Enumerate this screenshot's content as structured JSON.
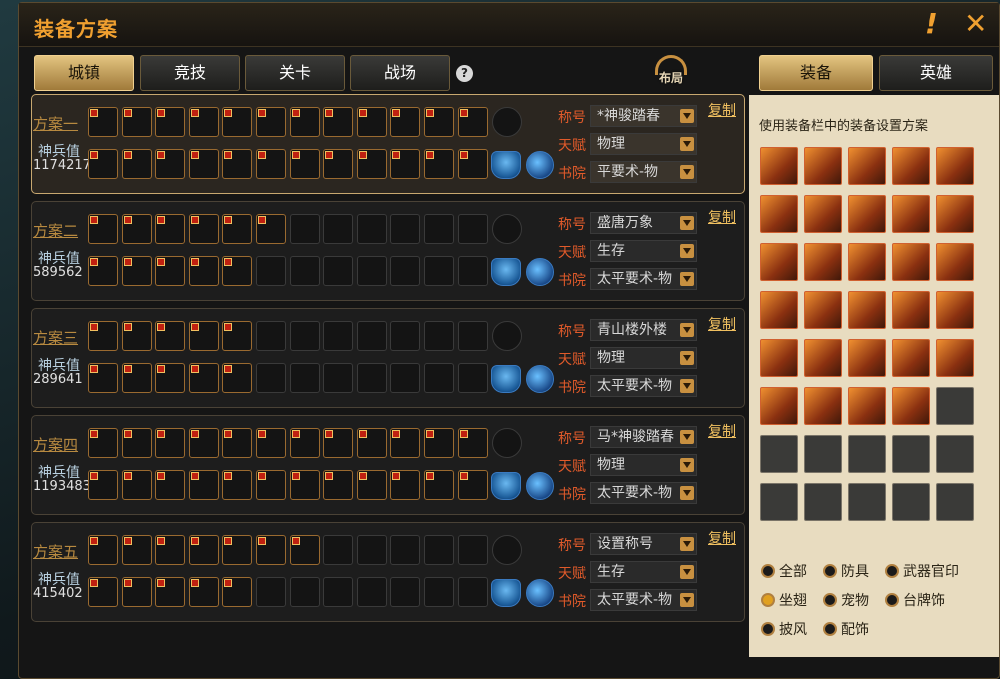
{
  "window": {
    "title": "装备方案",
    "help_mark": "!",
    "close_mark": "✕"
  },
  "left_tabs": [
    {
      "label": "城镇",
      "active": true
    },
    {
      "label": "竞技",
      "active": false
    },
    {
      "label": "关卡",
      "active": false
    },
    {
      "label": "战场",
      "active": false
    }
  ],
  "help_icon": "?",
  "layout_icon_label": "布局",
  "right_tabs": [
    {
      "label": "装备",
      "active": true
    },
    {
      "label": "英雄",
      "active": false
    }
  ],
  "field_labels": {
    "title": "称号",
    "talent": "天赋",
    "academy": "书院",
    "value_label": "神兵值",
    "copy": "复制"
  },
  "schemes": [
    {
      "name": "方案一",
      "value": "1174217",
      "title": "*神骏踏春",
      "talent": "物理",
      "academy": "平要术-物",
      "active": true,
      "row1_filled": 12,
      "row2_filled": 12
    },
    {
      "name": "方案二",
      "value": "589562",
      "title": "盛唐万象",
      "talent": "生存",
      "academy": "太平要术-物",
      "active": false,
      "row1_filled": 6,
      "row2_filled": 5
    },
    {
      "name": "方案三",
      "value": "289641",
      "title": "青山楼外楼",
      "talent": "物理",
      "academy": "太平要术-物",
      "active": false,
      "row1_filled": 5,
      "row2_filled": 5
    },
    {
      "name": "方案四",
      "value": "1193483",
      "title": "马*神骏踏春",
      "talent": "物理",
      "academy": "太平要术-物",
      "active": false,
      "row1_filled": 12,
      "row2_filled": 12
    },
    {
      "name": "方案五",
      "value": "415402",
      "title": "设置称号",
      "talent": "生存",
      "academy": "太平要术-物",
      "active": false,
      "row1_filled": 7,
      "row2_filled": 5
    }
  ],
  "panel": {
    "description": "使用装备栏中的装备设置方案",
    "filled_items": 29,
    "total_slots": 40,
    "filters": [
      {
        "label": "全部",
        "on": false
      },
      {
        "label": "防具",
        "on": false
      },
      {
        "label": "武器官印",
        "on": false
      },
      {
        "label": "坐翅",
        "on": true
      },
      {
        "label": "宠物",
        "on": false
      },
      {
        "label": "台牌饰",
        "on": false
      },
      {
        "label": "披风",
        "on": false
      },
      {
        "label": "配饰",
        "on": false
      }
    ]
  }
}
